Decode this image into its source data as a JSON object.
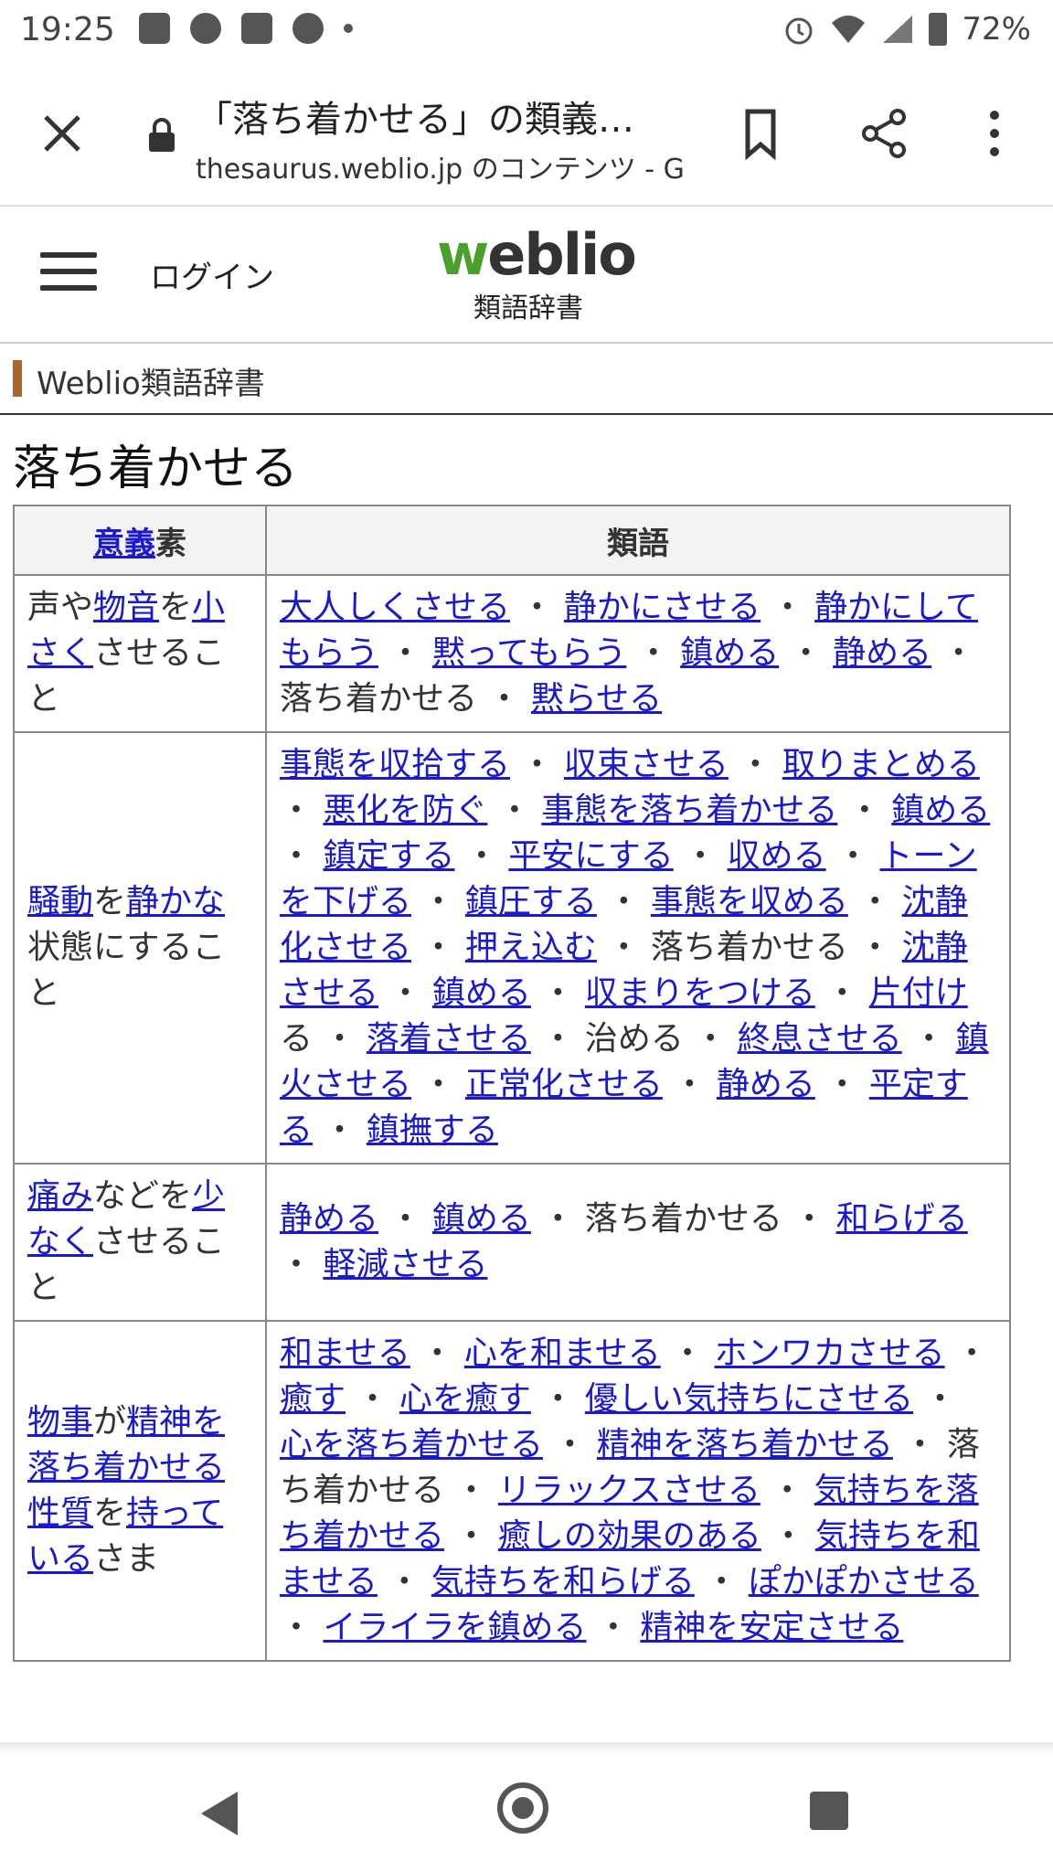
{
  "status_bar": {
    "time": "19:25",
    "battery": "72%"
  },
  "browser": {
    "title": "「落ち着かせる」の類義…",
    "url": "thesaurus.weblio.jp のコンテンツ - G"
  },
  "site": {
    "login": "ログイン",
    "logo_w": "w",
    "logo_rest": "eblio",
    "logo_sub": "類語辞書",
    "breadcrumb": "Weblio類語辞書",
    "heading": "落ち着かせる"
  },
  "table": {
    "header_meaning_link": "意義",
    "header_meaning_rest": "素",
    "header_synonyms": "類語",
    "rows": [
      {
        "meaning": [
          {
            "t": "声や"
          },
          {
            "t": "物音",
            "link": true
          },
          {
            "t": "を"
          },
          {
            "t": "小さく",
            "link": true
          },
          {
            "t": "させること"
          }
        ],
        "synonyms": [
          {
            "t": "大人しくさせる",
            "link": true
          },
          {
            "t": "静かにさせる",
            "link": true
          },
          {
            "t": "静かにしてもらう",
            "link": true
          },
          {
            "t": "黙ってもらう",
            "link": true
          },
          {
            "t": "鎮める",
            "link": true
          },
          {
            "t": "静める",
            "link": true
          },
          {
            "t": "落ち着かせる"
          },
          {
            "t": "黙らせる",
            "link": true
          }
        ]
      },
      {
        "meaning": [
          {
            "t": "騒動",
            "link": true
          },
          {
            "t": "を"
          },
          {
            "t": "静かな",
            "link": true
          },
          {
            "t": "状態にすること"
          }
        ],
        "synonyms": [
          {
            "t": "事態を収拾する",
            "link": true
          },
          {
            "t": "収束させる",
            "link": true
          },
          {
            "t": "取りまとめる",
            "link": true
          },
          {
            "t": "悪化を防ぐ",
            "link": true
          },
          {
            "t": "事態を落ち着かせる",
            "link": true
          },
          {
            "t": "鎮める",
            "link": true
          },
          {
            "t": "鎮定する",
            "link": true
          },
          {
            "t": "平安にする",
            "link": true
          },
          {
            "t": "収める",
            "link": true
          },
          {
            "t": "トーンを下げる",
            "link": true
          },
          {
            "t": "鎮圧する",
            "link": true
          },
          {
            "t": "事態を収める",
            "link": true
          },
          {
            "t": "沈静化させる",
            "link": true
          },
          {
            "t": "押え込む",
            "link": true
          },
          {
            "t": "落ち着かせる"
          },
          {
            "t": "沈静させる",
            "link": true
          },
          {
            "t": "鎮める",
            "link": true
          },
          {
            "t": "収まりをつける",
            "link": true
          },
          {
            "t": "片付け",
            "link": true,
            "suffix": "る"
          },
          {
            "t": "落着させる",
            "link": true
          },
          {
            "t": "治める"
          },
          {
            "t": "終息させる",
            "link": true
          },
          {
            "t": "鎮火させる",
            "link": true
          },
          {
            "t": "正常化させる",
            "link": true
          },
          {
            "t": "静める",
            "link": true
          },
          {
            "t": "平定する",
            "link": true
          },
          {
            "t": "鎮撫する",
            "link": true
          }
        ]
      },
      {
        "meaning": [
          {
            "t": "痛み",
            "link": true
          },
          {
            "t": "などを"
          },
          {
            "t": "少なく",
            "link": true
          },
          {
            "t": "させること"
          }
        ],
        "synonyms": [
          {
            "t": "静める",
            "link": true
          },
          {
            "t": "鎮める",
            "link": true
          },
          {
            "t": "落ち着かせる"
          },
          {
            "t": "和らげる",
            "link": true
          },
          {
            "t": "軽減させる",
            "link": true
          }
        ]
      },
      {
        "meaning": [
          {
            "t": "物事",
            "link": true
          },
          {
            "t": "が"
          },
          {
            "t": "精神を落ち着かせる",
            "link": true
          },
          {
            "t": "性質",
            "link": true
          },
          {
            "t": "を"
          },
          {
            "t": "持っている",
            "link": true
          },
          {
            "t": "さま"
          }
        ],
        "synonyms": [
          {
            "t": "和ませる",
            "link": true
          },
          {
            "t": "心を和ませる",
            "link": true
          },
          {
            "t": "ホンワカさせる",
            "link": true
          },
          {
            "t": "癒す",
            "link": true
          },
          {
            "t": "心を癒す",
            "link": true
          },
          {
            "t": "優しい気持ちにさせる",
            "link": true
          },
          {
            "t": "心を落ち着かせる",
            "link": true
          },
          {
            "t": "精神を落ち着かせる",
            "link": true
          },
          {
            "t": "落ち着かせる"
          },
          {
            "t": "リラックスさせる",
            "link": true
          },
          {
            "t": "気持ちを落ち着かせる",
            "link": true
          },
          {
            "t": "癒しの効果のある",
            "link": true
          },
          {
            "t": "気持ちを和ませる",
            "link": true
          },
          {
            "t": "気持ちを和らげる",
            "link": true
          },
          {
            "t": "ぽかぽかさせる",
            "link": true
          },
          {
            "t": "イライラを鎮める",
            "link": true
          },
          {
            "t": "精神を安定させる",
            "link": true
          }
        ]
      }
    ]
  }
}
